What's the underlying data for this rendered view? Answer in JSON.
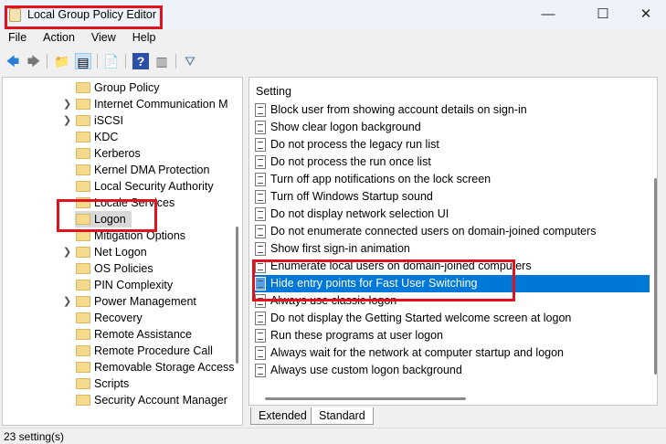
{
  "window": {
    "title": "Local Group Policy Editor",
    "minimize": "—",
    "maximize": "☐",
    "close": "✕"
  },
  "menu": [
    "File",
    "Action",
    "View",
    "Help"
  ],
  "toolbar": {
    "back": "🡄",
    "forward": "🡆",
    "up": "📁",
    "show_hide": "▤",
    "export": "📄",
    "help": "?",
    "properties": "▥",
    "filter": "⛛"
  },
  "tree": [
    {
      "label": "Group Policy",
      "expandable": false
    },
    {
      "label": "Internet Communication M",
      "expandable": true
    },
    {
      "label": "iSCSI",
      "expandable": true
    },
    {
      "label": "KDC",
      "expandable": false
    },
    {
      "label": "Kerberos",
      "expandable": false
    },
    {
      "label": "Kernel DMA Protection",
      "expandable": false
    },
    {
      "label": "Local Security Authority",
      "expandable": false
    },
    {
      "label": "Locale Services",
      "expandable": false
    },
    {
      "label": "Logon",
      "expandable": false,
      "selected": true
    },
    {
      "label": "Mitigation Options",
      "expandable": false
    },
    {
      "label": "Net Logon",
      "expandable": true
    },
    {
      "label": "OS Policies",
      "expandable": false
    },
    {
      "label": "PIN Complexity",
      "expandable": false
    },
    {
      "label": "Power Management",
      "expandable": true
    },
    {
      "label": "Recovery",
      "expandable": false
    },
    {
      "label": "Remote Assistance",
      "expandable": false
    },
    {
      "label": "Remote Procedure Call",
      "expandable": false
    },
    {
      "label": "Removable Storage Access",
      "expandable": false
    },
    {
      "label": "Scripts",
      "expandable": false
    },
    {
      "label": "Security Account Manager",
      "expandable": false
    }
  ],
  "settings": {
    "header": "Setting",
    "items": [
      "Block user from showing account details on sign-in",
      "Show clear logon background",
      "Do not process the legacy run list",
      "Do not process the run once list",
      "Turn off app notifications on the lock screen",
      "Turn off Windows Startup sound",
      "Do not display network selection UI",
      "Do not enumerate connected users on domain-joined computers",
      "Show first sign-in animation",
      "Enumerate local users on domain-joined computers",
      "Hide entry points for Fast User Switching",
      "Always use classic logon",
      "Do not display the Getting Started welcome screen at logon",
      "Run these programs at user logon",
      "Always wait for the network at computer startup and logon",
      "Always use custom logon background"
    ],
    "selected_index": 10
  },
  "tabs": [
    "Extended",
    "Standard"
  ],
  "status": "23 setting(s)"
}
